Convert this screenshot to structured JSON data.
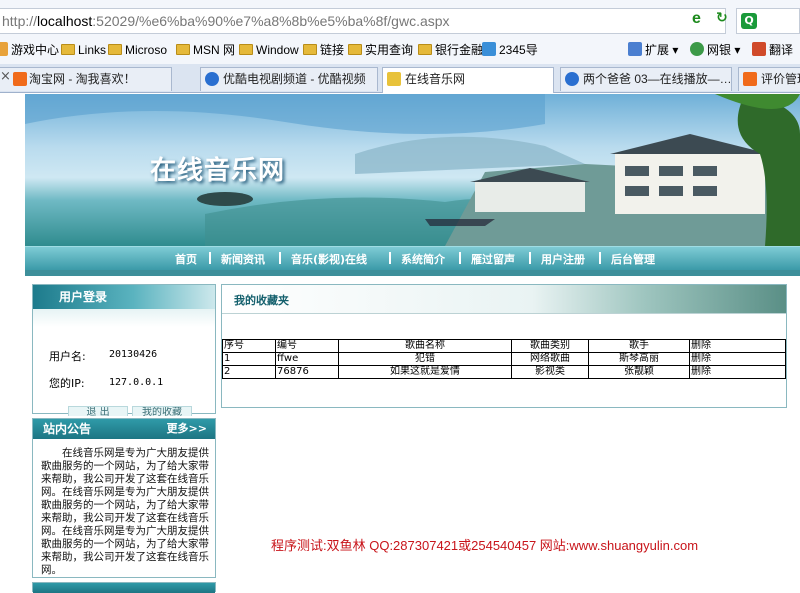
{
  "browser": {
    "url_prefix": "http://",
    "url_host": "localhost",
    "url_rest": ":52029/%e6%ba%90%e7%a8%8b%e5%ba%8f/gwc.aspx",
    "favorites": [
      "游戏中心",
      "Links",
      "Microso",
      "MSN 网",
      "Window",
      "链接",
      "实用查询",
      "银行金融",
      "2345导"
    ],
    "tools": {
      "extend": "扩展",
      "netbank": "网银",
      "translate": "翻译"
    },
    "tabs": [
      {
        "title": "淘宝网 - 淘我喜欢！",
        "active": false
      },
      {
        "title": "优酷电视剧频道 - 优酷视频",
        "active": false
      },
      {
        "title": "在线音乐网",
        "active": true
      },
      {
        "title": "两个爸爸 03—在线播放—…",
        "active": false
      },
      {
        "title": "评价管理",
        "active": false
      }
    ]
  },
  "site": {
    "title": "在线音乐网",
    "nav": [
      "首页",
      "新闻资讯",
      "音乐(影视)在线",
      "系统简介",
      "雁过留声",
      "用户注册",
      "后台管理"
    ]
  },
  "login": {
    "header": "用户登录",
    "username_label": "用户名:",
    "username": "20130426",
    "ip_label": "您的IP:",
    "ip": "127.0.0.1",
    "logout": "退 出",
    "favorites_btn": "我的收藏"
  },
  "notice": {
    "header": "站内公告",
    "more": "更多>>",
    "body": "在线音乐网是专为广大朋友提供歌曲服务的一个网站，为了给大家带来帮助，我公司开发了这套在线音乐网。在线音乐网是专为广大朋友提供歌曲服务的一个网站，为了给大家带来帮助，我公司开发了这套在线音乐网。在线音乐网是专为广大朋友提供歌曲服务的一个网站，为了给大家带来帮助，我公司开发了这套在线音乐网。"
  },
  "favorites": {
    "title": "我的收藏夹",
    "columns": [
      "序号",
      "编号",
      "歌曲名称",
      "歌曲类别",
      "歌手",
      "删除"
    ],
    "rows": [
      [
        "1",
        "ffwe",
        "犯错",
        "网络歌曲",
        "斯琴高丽",
        "删除"
      ],
      [
        "2",
        "76876",
        "如果这就是爱情",
        "影视类",
        "张靓颖",
        "删除"
      ]
    ]
  },
  "footer": "程序测试:双鱼林 QQ:287307421或254540457 网站:www.shuangyulin.com"
}
